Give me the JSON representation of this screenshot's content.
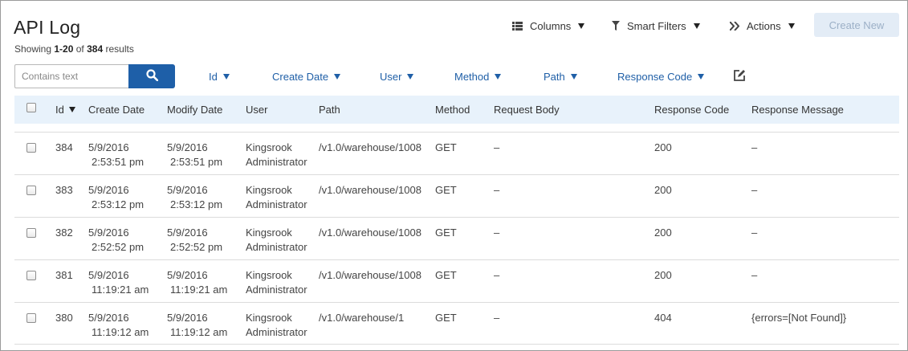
{
  "page": {
    "title": "API Log",
    "showing_prefix": "Showing",
    "showing_range": "1-20",
    "showing_of": "of",
    "showing_total": "384",
    "showing_suffix": "results"
  },
  "toolbar": {
    "columns_label": "Columns",
    "smart_filters_label": "Smart Filters",
    "actions_label": "Actions",
    "create_new_label": "Create New"
  },
  "search": {
    "placeholder": "Contains text",
    "value": ""
  },
  "filters": [
    "Id",
    "Create Date",
    "User",
    "Method",
    "Path",
    "Response Code"
  ],
  "table": {
    "columns": [
      "Id",
      "Create Date",
      "Modify Date",
      "User",
      "Path",
      "Method",
      "Request Body",
      "Response Code",
      "Response Message"
    ],
    "sort_column": "Id",
    "rows": [
      {
        "id": "384",
        "create_date": "5/9/2016",
        "create_time": "2:53:51 pm",
        "modify_date": "5/9/2016",
        "modify_time": "2:53:51 pm",
        "user_first": "Kingsrook",
        "user_last": "Administrator",
        "path": "/v1.0/warehouse/1008",
        "method": "GET",
        "request_body": "–",
        "response_code": "200",
        "response_message": "–"
      },
      {
        "id": "383",
        "create_date": "5/9/2016",
        "create_time": "2:53:12 pm",
        "modify_date": "5/9/2016",
        "modify_time": "2:53:12 pm",
        "user_first": "Kingsrook",
        "user_last": "Administrator",
        "path": "/v1.0/warehouse/1008",
        "method": "GET",
        "request_body": "–",
        "response_code": "200",
        "response_message": "–"
      },
      {
        "id": "382",
        "create_date": "5/9/2016",
        "create_time": "2:52:52 pm",
        "modify_date": "5/9/2016",
        "modify_time": "2:52:52 pm",
        "user_first": "Kingsrook",
        "user_last": "Administrator",
        "path": "/v1.0/warehouse/1008",
        "method": "GET",
        "request_body": "–",
        "response_code": "200",
        "response_message": "–"
      },
      {
        "id": "381",
        "create_date": "5/9/2016",
        "create_time": "11:19:21 am",
        "modify_date": "5/9/2016",
        "modify_time": "11:19:21 am",
        "user_first": "Kingsrook",
        "user_last": "Administrator",
        "path": "/v1.0/warehouse/1008",
        "method": "GET",
        "request_body": "–",
        "response_code": "200",
        "response_message": "–"
      },
      {
        "id": "380",
        "create_date": "5/9/2016",
        "create_time": "11:19:12 am",
        "modify_date": "5/9/2016",
        "modify_time": "11:19:12 am",
        "user_first": "Kingsrook",
        "user_last": "Administrator",
        "path": "/v1.0/warehouse/1",
        "method": "GET",
        "request_body": "–",
        "response_code": "404",
        "response_message": "{errors=[Not Found]}"
      }
    ]
  },
  "colors": {
    "accent": "#1e5fa8",
    "header_bg": "#e8f2fb",
    "create_new_bg": "#e3ecf6"
  },
  "icons": {
    "columns": "list-icon",
    "smart_filters": "filter-icon",
    "actions": "double-chevron-icon",
    "search": "search-icon",
    "edit": "edit-icon"
  }
}
